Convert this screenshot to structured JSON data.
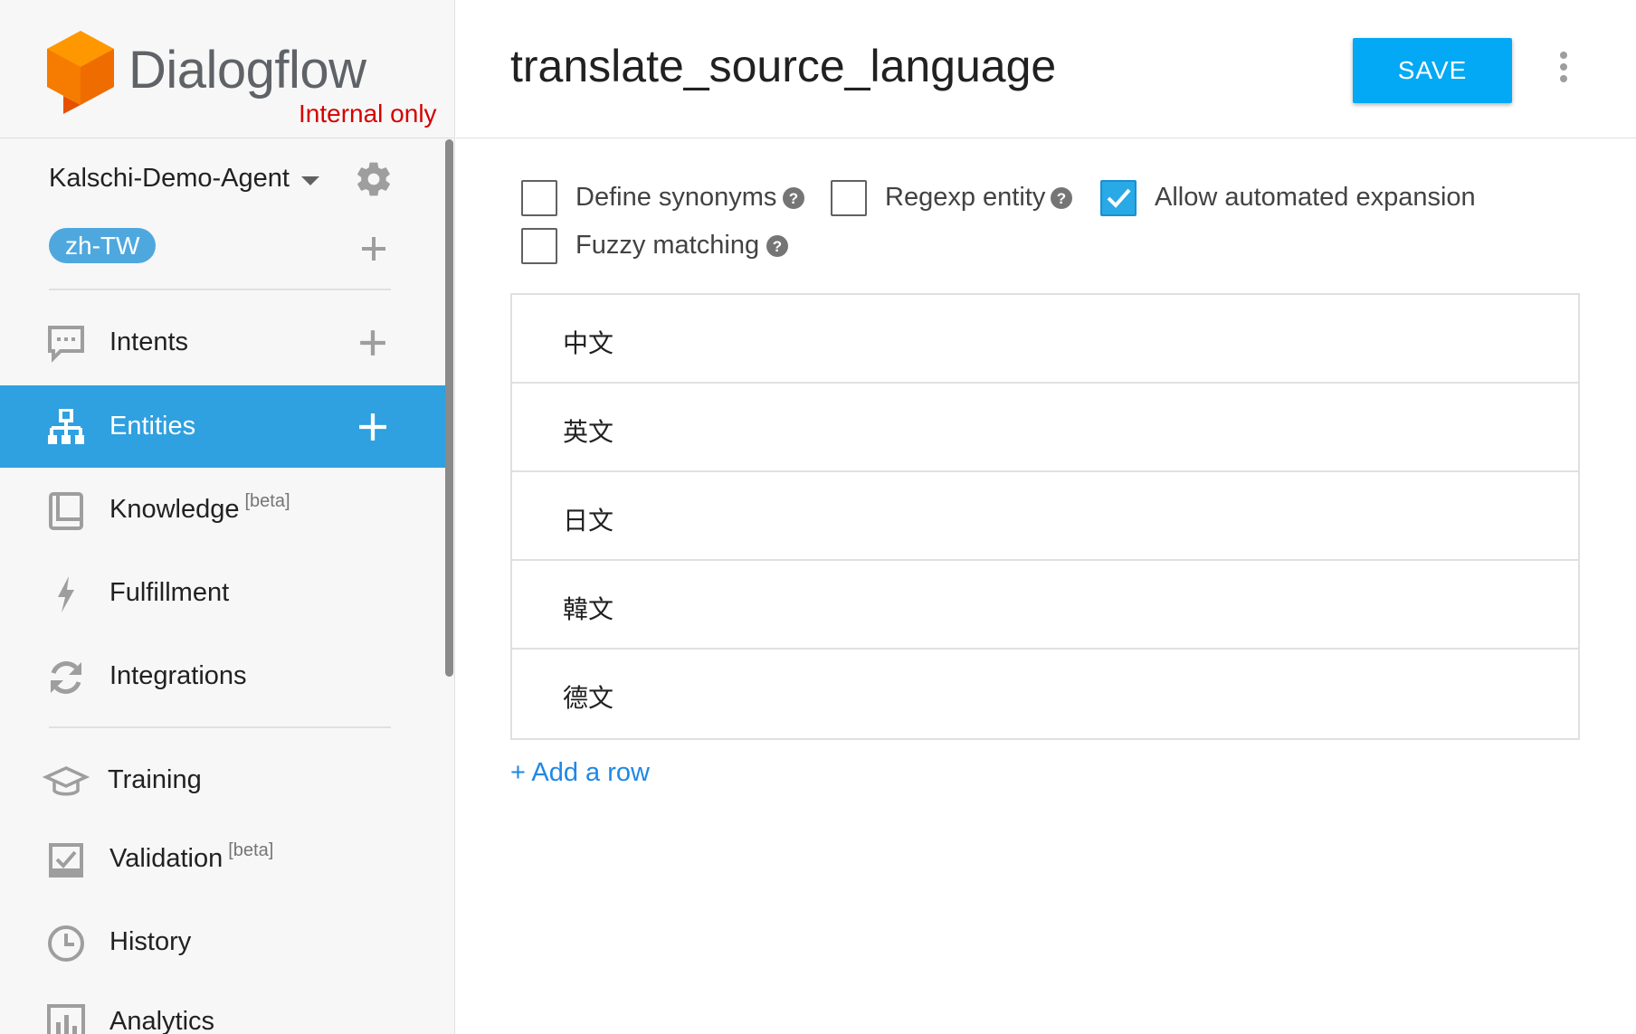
{
  "brand": {
    "name": "Dialogflow",
    "tagline": "Internal only",
    "logo_colors": [
      "#ff9800",
      "#ef6c00",
      "#e65100"
    ]
  },
  "sidebar": {
    "agent_name": "Kalschi-Demo-Agent",
    "language_chip": "zh-TW",
    "items": [
      {
        "label": "Intents",
        "icon": "chat-bubble-icon",
        "has_add": true,
        "active": false
      },
      {
        "label": "Entities",
        "icon": "entities-tree-icon",
        "has_add": true,
        "active": true
      },
      {
        "label": "Knowledge",
        "badge": "[beta]",
        "icon": "book-icon",
        "has_add": false,
        "active": false
      },
      {
        "label": "Fulfillment",
        "icon": "lightning-icon",
        "has_add": false,
        "active": false
      },
      {
        "label": "Integrations",
        "icon": "sync-icon",
        "has_add": false,
        "active": false
      },
      {
        "label": "Training",
        "icon": "graduation-cap-icon",
        "has_add": false,
        "active": false
      },
      {
        "label": "Validation",
        "badge": "[beta]",
        "icon": "check-box-icon",
        "has_add": false,
        "active": false
      },
      {
        "label": "History",
        "icon": "clock-icon",
        "has_add": false,
        "active": false
      },
      {
        "label": "Analytics",
        "icon": "bar-chart-icon",
        "has_add": false,
        "active": false
      }
    ],
    "active_color": "#2fa0e0"
  },
  "header": {
    "entity_name": "translate_source_language",
    "save_label": "SAVE",
    "save_color": "#03a9f4"
  },
  "options": [
    {
      "label": "Define synonyms",
      "checked": false,
      "has_help": true
    },
    {
      "label": "Regexp entity",
      "checked": false,
      "has_help": true
    },
    {
      "label": "Allow automated expansion",
      "checked": true,
      "has_help": false
    },
    {
      "label": "Fuzzy matching",
      "checked": false,
      "has_help": true
    }
  ],
  "entries": [
    "中文",
    "英文",
    "日文",
    "韓文",
    "德文"
  ],
  "add_row_label": "+ Add a row"
}
